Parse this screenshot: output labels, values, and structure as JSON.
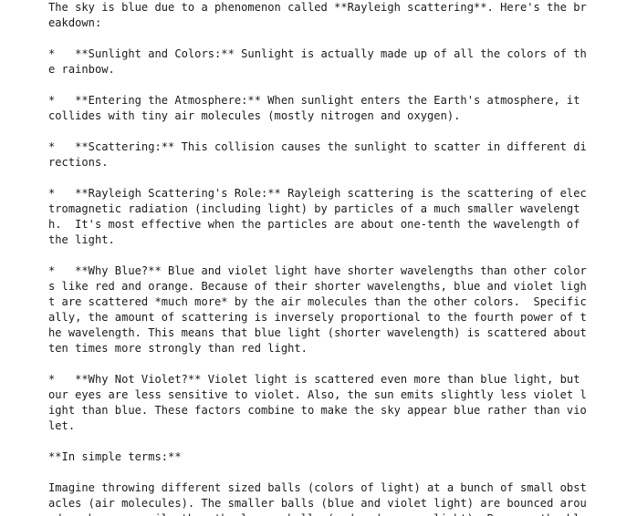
{
  "lines": [
    "The sky is blue due to a phenomenon called **Rayleigh scattering**. Here's the br",
    "eakdown:",
    "",
    "*   **Sunlight and Colors:** Sunlight is actually made up of all the colors of th",
    "e rainbow.",
    "",
    "*   **Entering the Atmosphere:** When sunlight enters the Earth's atmosphere, it",
    "collides with tiny air molecules (mostly nitrogen and oxygen).",
    "",
    "*   **Scattering:** This collision causes the sunlight to scatter in different di",
    "rections.",
    "",
    "*   **Rayleigh Scattering's Role:** Rayleigh scattering is the scattering of elec",
    "tromagnetic radiation (including light) by particles of a much smaller wavelengt",
    "h.  It's most effective when the particles are about one-tenth the wavelength of",
    "the light.",
    "",
    "*   **Why Blue?** Blue and violet light have shorter wavelengths than other color",
    "s like red and orange. Because of their shorter wavelengths, blue and violet ligh",
    "t are scattered *much more* by the air molecules than the other colors.  Specific",
    "ally, the amount of scattering is inversely proportional to the fourth power of t",
    "he wavelength. This means that blue light (shorter wavelength) is scattered about",
    "ten times more strongly than red light.",
    "",
    "*   **Why Not Violet?** Violet light is scattered even more than blue light, but",
    "our eyes are less sensitive to violet. Also, the sun emits slightly less violet l",
    "ight than blue. These factors combine to make the sky appear blue rather than vio",
    "let.",
    "",
    "**In simple terms:**",
    "",
    "Imagine throwing different sized balls (colors of light) at a bunch of small obst",
    "acles (air molecules). The smaller balls (blue and violet light) are bounced arou",
    "nd much more easily than the larger balls (red and orange light). Because the blu"
  ]
}
